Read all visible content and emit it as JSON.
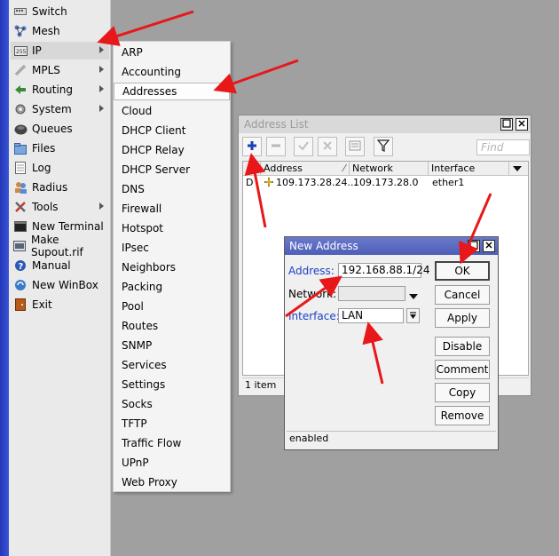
{
  "sidebar": {
    "items": [
      {
        "label": "Switch",
        "icon": "switch-icon"
      },
      {
        "label": "Mesh",
        "icon": "mesh-icon"
      },
      {
        "label": "IP",
        "icon": "ip-icon",
        "has_submenu": true
      },
      {
        "label": "MPLS",
        "icon": "mpls-icon",
        "has_submenu": true
      },
      {
        "label": "Routing",
        "icon": "routing-icon",
        "has_submenu": true
      },
      {
        "label": "System",
        "icon": "system-icon",
        "has_submenu": true
      },
      {
        "label": "Queues",
        "icon": "queues-icon"
      },
      {
        "label": "Files",
        "icon": "files-icon"
      },
      {
        "label": "Log",
        "icon": "log-icon"
      },
      {
        "label": "Radius",
        "icon": "radius-icon"
      },
      {
        "label": "Tools",
        "icon": "tools-icon",
        "has_submenu": true
      },
      {
        "label": "New Terminal",
        "icon": "terminal-icon"
      },
      {
        "label": "Make Supout.rif",
        "icon": "supout-icon"
      },
      {
        "label": "Manual",
        "icon": "manual-icon"
      },
      {
        "label": "New WinBox",
        "icon": "winbox-icon"
      },
      {
        "label": "Exit",
        "icon": "exit-icon"
      }
    ]
  },
  "ip_submenu": {
    "items": [
      "ARP",
      "Accounting",
      "Addresses",
      "Cloud",
      "DHCP Client",
      "DHCP Relay",
      "DHCP Server",
      "DNS",
      "Firewall",
      "Hotspot",
      "IPsec",
      "Neighbors",
      "Packing",
      "Pool",
      "Routes",
      "SNMP",
      "Services",
      "Settings",
      "Socks",
      "TFTP",
      "Traffic Flow",
      "UPnP",
      "Web Proxy"
    ]
  },
  "address_list": {
    "title": "Address List",
    "find_placeholder": "Find",
    "columns": [
      "Address",
      "Network",
      "Interface"
    ],
    "rows": [
      {
        "flag": "D",
        "address": "109.173.28.24...",
        "network": "109.173.28.0",
        "interface": "ether1"
      }
    ],
    "status": "1 item"
  },
  "new_address": {
    "title": "New Address",
    "address_label": "Address:",
    "address_value": "192.168.88.1/24",
    "network_label": "Network:",
    "network_value": "",
    "interface_label": "Interface:",
    "interface_value": "LAN",
    "buttons": [
      "OK",
      "Cancel",
      "Apply",
      "Disable",
      "Comment",
      "Copy",
      "Remove"
    ],
    "status": "enabled"
  },
  "colors": {
    "annotation_arrow": "#e8181a",
    "dialog_title": "#5565bf",
    "label_blue": "#1a3ec8",
    "sidebar_bar": "#2437b9"
  }
}
